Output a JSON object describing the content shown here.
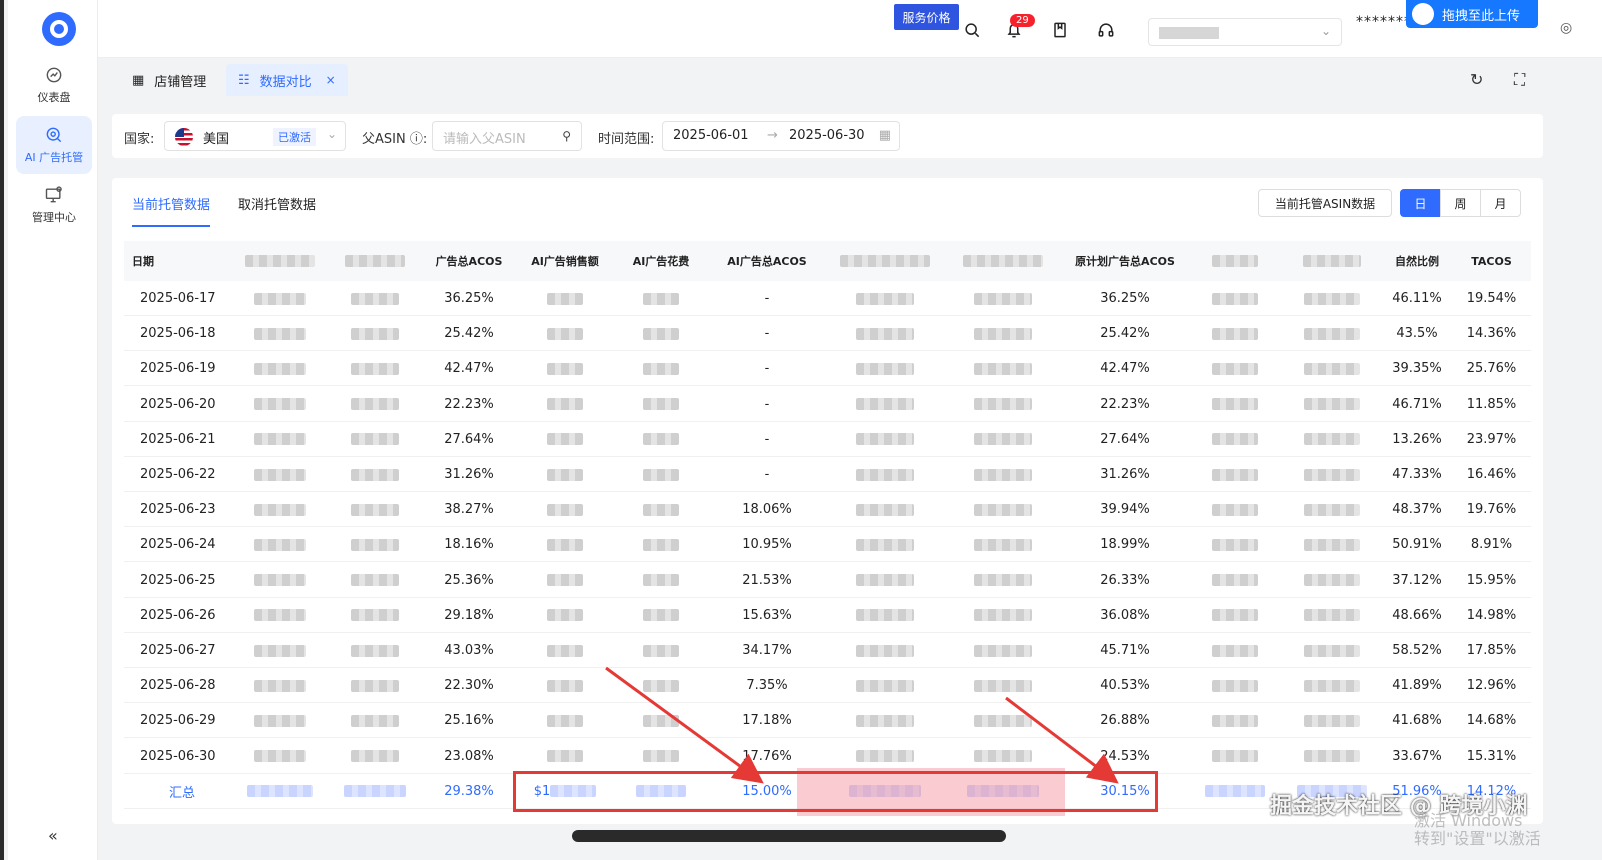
{
  "sidebar": {
    "items": [
      {
        "label": "仪表盘"
      },
      {
        "label": "AI 广告托管"
      },
      {
        "label": "管理中心"
      }
    ],
    "collapse": "«"
  },
  "topbar": {
    "price_button": "服务价格",
    "notif_count": "29",
    "password_mask": "*******",
    "upload_label": "拖拽至此上传"
  },
  "tabs": [
    {
      "label": "店铺管理"
    },
    {
      "label": "数据对比",
      "close": "×"
    }
  ],
  "filter": {
    "country_label": "国家:",
    "country_value": "美国",
    "country_status": "已激活",
    "asin_label": "父ASIN ⓘ:",
    "asin_placeholder": "请输入父ASIN",
    "date_label": "时间范围:",
    "date_start": "2025-06-01",
    "date_arrow": "→",
    "date_end": "2025-06-30"
  },
  "subtabs": [
    {
      "label": "当前托管数据"
    },
    {
      "label": "取消托管数据"
    }
  ],
  "asin_button": "当前托管ASIN数据",
  "period": [
    "日",
    "周",
    "月"
  ],
  "columns": {
    "date": "日期",
    "ad_acos": "广告总ACOS",
    "ai_sales": "AI广告销售额",
    "ai_spend": "AI广告花费",
    "ai_acos": "AI广告总ACOS",
    "orig_acos": "原计划广告总ACOS",
    "natural_ratio": "自然比例",
    "tacos": "TACOS"
  },
  "rows": [
    {
      "date": "2025-06-17",
      "ad_acos": "36.25%",
      "ai_acos": "-",
      "orig_acos": "36.25%",
      "natural": "46.11%",
      "tacos": "19.54%"
    },
    {
      "date": "2025-06-18",
      "ad_acos": "25.42%",
      "ai_acos": "-",
      "orig_acos": "25.42%",
      "natural": "43.5%",
      "tacos": "14.36%"
    },
    {
      "date": "2025-06-19",
      "ad_acos": "42.47%",
      "ai_acos": "-",
      "orig_acos": "42.47%",
      "natural": "39.35%",
      "tacos": "25.76%"
    },
    {
      "date": "2025-06-20",
      "ad_acos": "22.23%",
      "ai_acos": "-",
      "orig_acos": "22.23%",
      "natural": "46.71%",
      "tacos": "11.85%"
    },
    {
      "date": "2025-06-21",
      "ad_acos": "27.64%",
      "ai_acos": "-",
      "orig_acos": "27.64%",
      "natural": "13.26%",
      "tacos": "23.97%"
    },
    {
      "date": "2025-06-22",
      "ad_acos": "31.26%",
      "ai_acos": "-",
      "orig_acos": "31.26%",
      "natural": "47.33%",
      "tacos": "16.46%"
    },
    {
      "date": "2025-06-23",
      "ad_acos": "38.27%",
      "ai_acos": "18.06%",
      "orig_acos": "39.94%",
      "natural": "48.37%",
      "tacos": "19.76%"
    },
    {
      "date": "2025-06-24",
      "ad_acos": "18.16%",
      "ai_acos": "10.95%",
      "orig_acos": "18.99%",
      "natural": "50.91%",
      "tacos": "8.91%"
    },
    {
      "date": "2025-06-25",
      "ad_acos": "25.36%",
      "ai_acos": "21.53%",
      "orig_acos": "26.33%",
      "natural": "37.12%",
      "tacos": "15.95%"
    },
    {
      "date": "2025-06-26",
      "ad_acos": "29.18%",
      "ai_acos": "15.63%",
      "orig_acos": "36.08%",
      "natural": "48.66%",
      "tacos": "14.98%"
    },
    {
      "date": "2025-06-27",
      "ad_acos": "43.03%",
      "ai_acos": "34.17%",
      "orig_acos": "45.71%",
      "natural": "58.52%",
      "tacos": "17.85%"
    },
    {
      "date": "2025-06-28",
      "ad_acos": "22.30%",
      "ai_acos": "7.35%",
      "orig_acos": "40.53%",
      "natural": "41.89%",
      "tacos": "12.96%"
    },
    {
      "date": "2025-06-29",
      "ad_acos": "25.16%",
      "ai_acos": "17.18%",
      "orig_acos": "26.88%",
      "natural": "41.68%",
      "tacos": "14.68%"
    },
    {
      "date": "2025-06-30",
      "ad_acos": "23.08%",
      "ai_acos": "17.76%",
      "orig_acos": "24.53%",
      "natural": "33.67%",
      "tacos": "15.31%"
    }
  ],
  "summary": {
    "label": "汇总",
    "ad_acos": "29.38%",
    "ai_sales_prefix": "$1",
    "ai_acos": "15.00%",
    "orig_acos": "30.15%",
    "natural": "51.96%",
    "tacos": "14.12%"
  },
  "watermark": "掘金技术社区 @ 跨境小渊",
  "win_activate": {
    "line1": "激活 Windows",
    "line2": "转到\"设置\"以激活"
  },
  "colors": {
    "accent": "#2f6bff",
    "annotation": "#e53935"
  }
}
